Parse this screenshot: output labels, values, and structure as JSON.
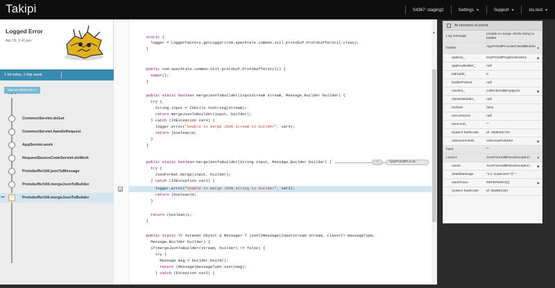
{
  "app": {
    "logo": "Takipi"
  },
  "nav": {
    "server": "S4367: staging2",
    "settings": "Settings",
    "support": "Support",
    "user": "iris.test"
  },
  "error": {
    "title": "Logged Error",
    "date": "Apr 15, 2:41 pm",
    "hits": "1 hit today, 1 this week",
    "host": "http-nio-8080-exec-1"
  },
  "frames": [
    "CommonServlet.doGet",
    "CommonServlet.handleRequest",
    "AppServlet.work",
    "RequestSourceCodeServlet.doWork",
    "ProtobufferUtil.jsonToMessage",
    "ProtobufferUtil.mergeJsonToBuilder",
    "ProtobufferUtil.mergeJsonToBuilder"
  ],
  "code": {
    "tip_small": "\"\"",
    "tip_value": "AppProto$PLocat..."
  },
  "variables": {
    "header": "At moment of event",
    "rows": [
      {
        "k": "Log message",
        "v": "Unable to merge JSON string to builder",
        "sub": false,
        "arrow": ""
      },
      {
        "k": "builder",
        "v": "AppProto$PLocateClass$Builder",
        "sub": false,
        "arrow": "▼"
      },
      {
        "k": "appKey_",
        "v": "KeyProto$PApplicationKey",
        "sub": true,
        "arrow": "▶"
      },
      {
        "k": "appKeyBuilder_",
        "v": "null",
        "sub": true,
        "arrow": ""
      },
      {
        "k": "bitField0_",
        "v": "0",
        "sub": true,
        "arrow": ""
      },
      {
        "k": "builderParent",
        "v": "null",
        "sub": true,
        "arrow": ""
      },
      {
        "k": "classes_",
        "v": "Collections$EmptyList",
        "sub": true,
        "arrow": "▶"
      },
      {
        "k": "classesBuilder_",
        "v": "null",
        "sub": true,
        "arrow": ""
      },
      {
        "k": "isClean",
        "v": "false",
        "sub": true,
        "arrow": ""
      },
      {
        "k": "meAsParent",
        "v": "null",
        "sub": true,
        "arrow": ""
      },
      {
        "k": "serviceId_",
        "v": "\"\"",
        "sub": true,
        "arrow": ""
      },
      {
        "k": "System hashcode",
        "v": "id: 1808401710",
        "sub": true,
        "arrow": ""
      },
      {
        "k": "unknownFields",
        "v": "UnknownFieldSet",
        "sub": true,
        "arrow": "▶"
      },
      {
        "k": "input",
        "v": "\"\"",
        "sub": false,
        "arrow": ""
      },
      {
        "k": "Local 2",
        "v": "JsonFormat$ParseException",
        "sub": false,
        "arrow": "▼"
      },
      {
        "k": "cause",
        "v": "JsonFormat$ParseException",
        "sub": true,
        "arrow": "▶"
      },
      {
        "k": "detailMessage",
        "v": "\"1:1: Expected \\\"{\\\".\"",
        "sub": true,
        "arrow": ""
      },
      {
        "k": "stackTrace",
        "v": "REFERENCE[]",
        "sub": true,
        "arrow": "▶"
      },
      {
        "k": "System hashcode",
        "v": "id: 354882164",
        "sub": true,
        "arrow": ""
      }
    ]
  }
}
